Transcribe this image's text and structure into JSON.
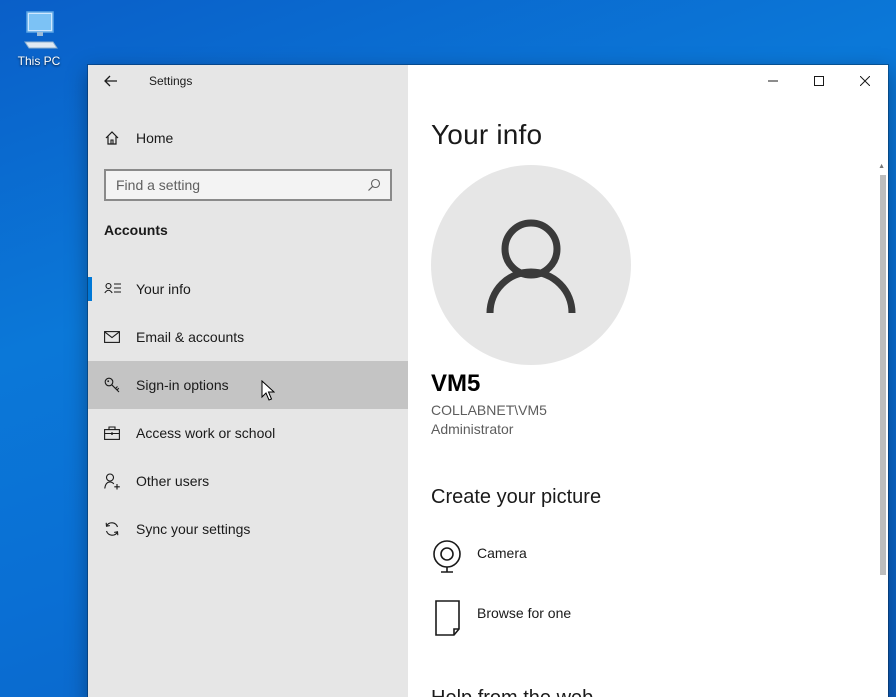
{
  "desktop": {
    "icon_label": "This PC"
  },
  "window": {
    "app_title": "Settings",
    "caption": {
      "minimize_icon": "minimize-icon",
      "maximize_icon": "maximize-icon",
      "close_icon": "close-icon"
    }
  },
  "sidebar": {
    "home_label": "Home",
    "search_placeholder": "Find a setting",
    "section_heading": "Accounts",
    "items": [
      {
        "label": "Your info",
        "icon": "contact-card-icon",
        "selected": true
      },
      {
        "label": "Email & accounts",
        "icon": "mail-icon"
      },
      {
        "label": "Sign-in options",
        "icon": "key-icon",
        "hovered": true
      },
      {
        "label": "Access work or school",
        "icon": "briefcase-icon"
      },
      {
        "label": "Other users",
        "icon": "add-user-icon"
      },
      {
        "label": "Sync your settings",
        "icon": "sync-icon"
      }
    ]
  },
  "main": {
    "page_title": "Your info",
    "user": {
      "name": "VM5",
      "domain": "COLLABNET\\VM5",
      "role": "Administrator"
    },
    "create_picture_heading": "Create your picture",
    "picture_options": [
      {
        "label": "Camera",
        "icon": "camera-icon"
      },
      {
        "label": "Browse for one",
        "icon": "file-icon"
      }
    ],
    "partial_heading": "Help from the web"
  },
  "colors": {
    "accent": "#0078d7",
    "sidebar_bg": "#e6e6e6",
    "hover_bg": "#c4c4c4",
    "desktop_bg": "#0b78d8"
  }
}
